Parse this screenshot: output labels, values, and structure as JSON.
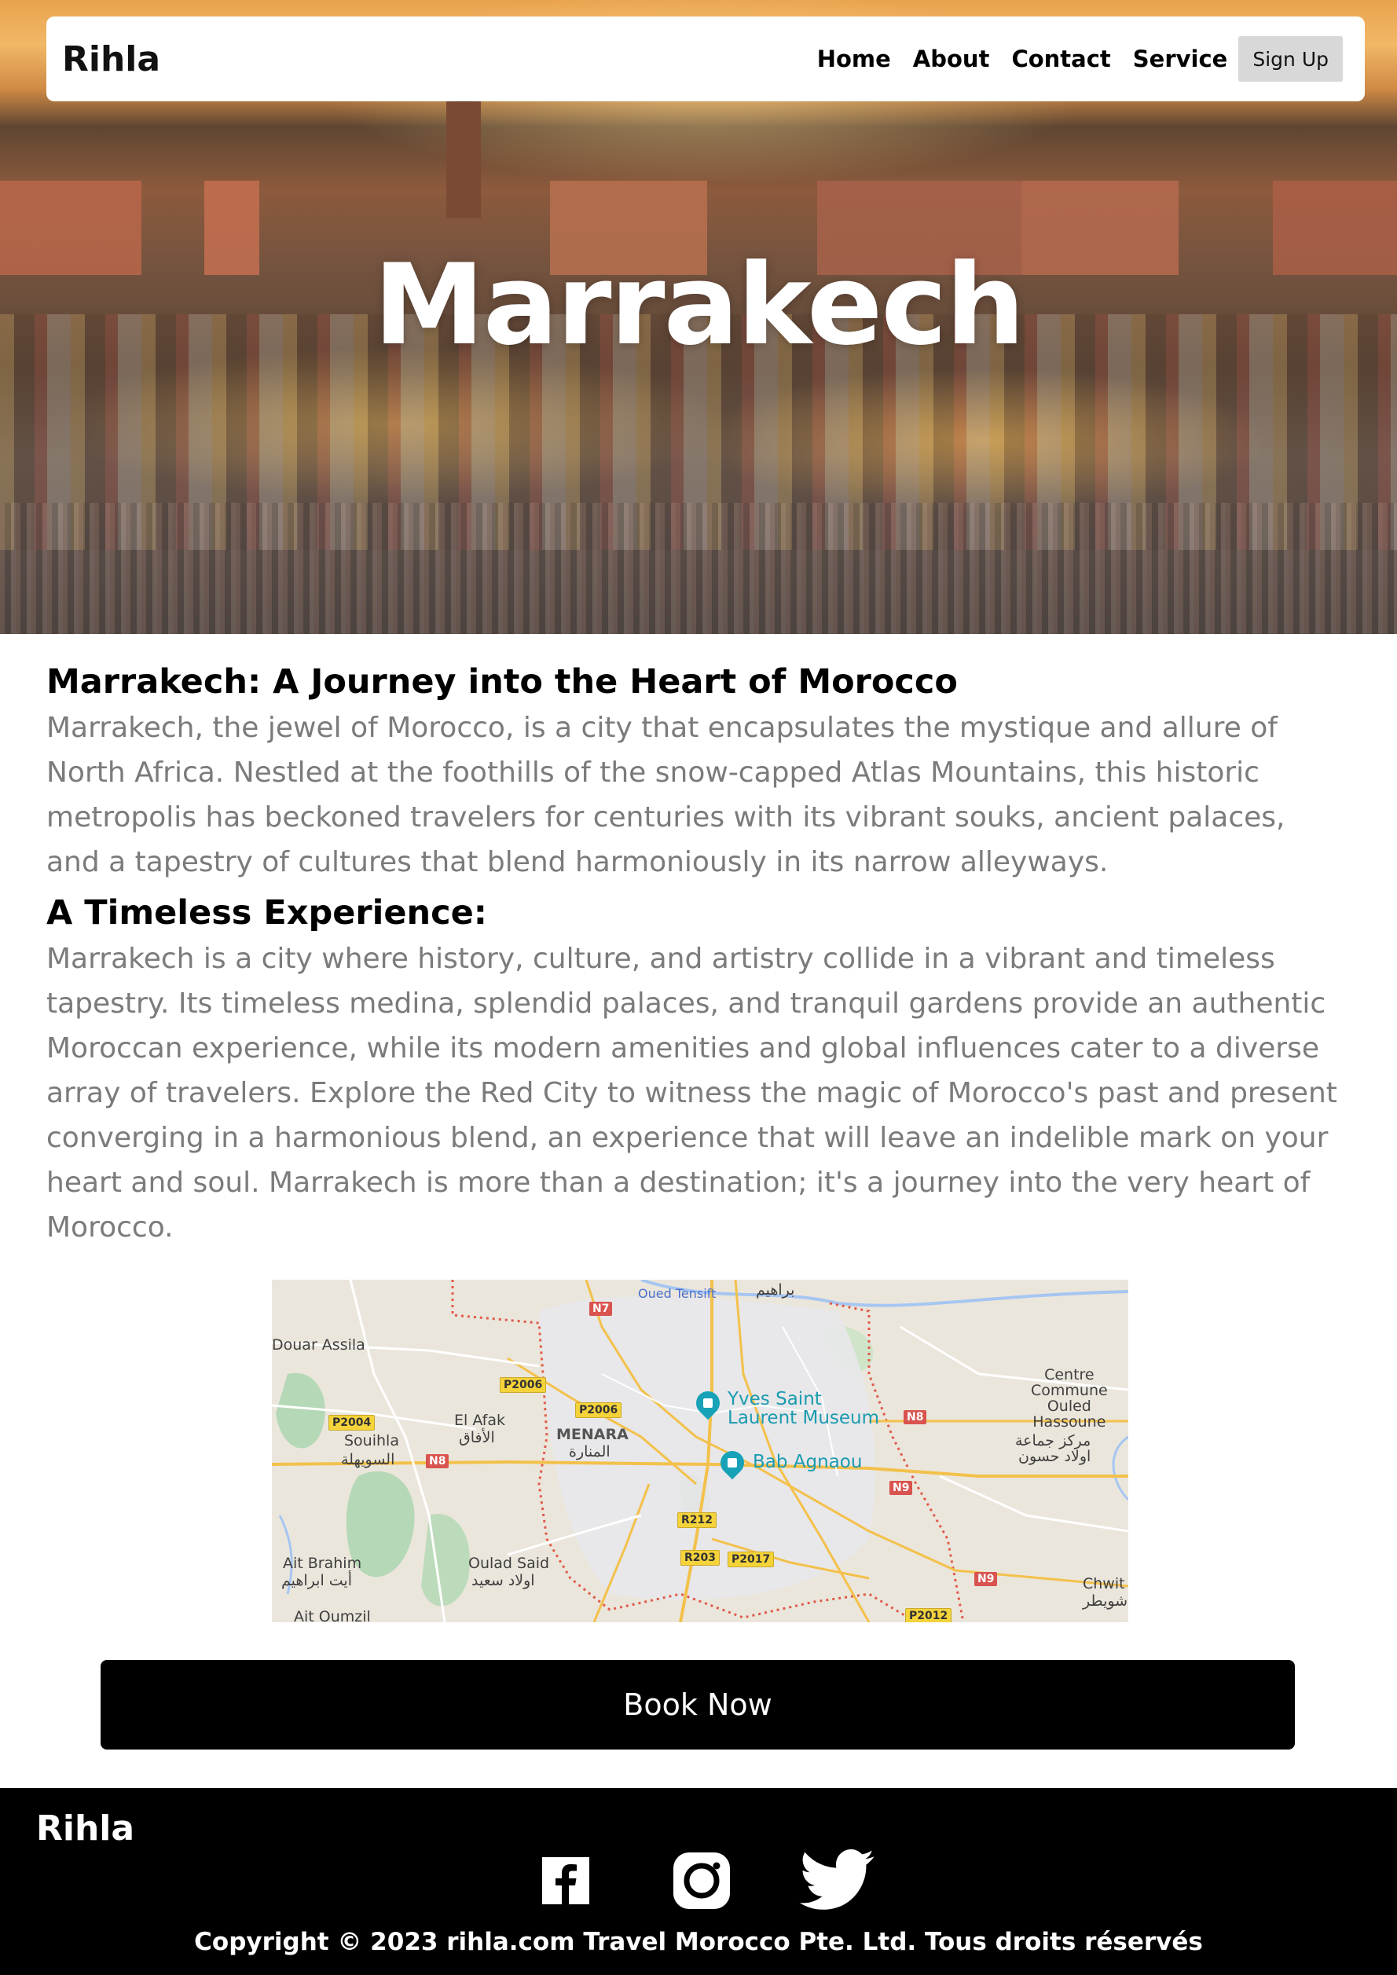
{
  "nav": {
    "brand": "Rihla",
    "links": [
      "Home",
      "About",
      "Contact",
      "Service"
    ],
    "signup_label": "Sign Up"
  },
  "hero": {
    "title": "Marrakech"
  },
  "article": {
    "heading1": "Marrakech: A Journey into the Heart of Morocco",
    "para1": "Marrakech, the jewel of Morocco, is a city that encapsulates the mystique and allure of North Africa. Nestled at the foothills of the snow-capped Atlas Mountains, this historic metropolis has beckoned travelers for centuries with its vibrant souks, ancient palaces, and a tapestry of cultures that blend harmoniously in its narrow alleyways.",
    "heading2": "A Timeless Experience:",
    "para2": "Marrakech is a city where history, culture, and artistry collide in a vibrant and timeless tapestry. Its timeless medina, splendid palaces, and tranquil gardens provide an authentic Moroccan experience, while its modern amenities and global influences cater to a diverse array of travelers. Explore the Red City to witness the magic of Morocco's past and present converging in a harmonious blend, an experience that will leave an indelible mark on your heart and soul. Marrakech is more than a destination; it's a journey into the very heart of Morocco."
  },
  "map": {
    "places": {
      "douar_assila": "Douar Assila",
      "el_afak": "El Afak",
      "el_afak_ar": "الأفاق",
      "souihla": "Souihla",
      "souihla_ar": "السويهلة",
      "menara": "MENARA",
      "menara_ar": "المنارة",
      "ysl_museum": "Yves Saint\nLaurent Museum",
      "bab_agnaou": "Bab Agnaou",
      "centre_ouled": "Centre\nCommune\nOuled\nHassoune",
      "centre_ouled_ar": "مركز جماعة\nاولاد حسون",
      "ait_brahim": "Ait Brahim",
      "ait_brahim_ar": "أيت ابراهيم",
      "oulad_said": "Oulad Said",
      "oulad_said_ar": "اولاد سعيد",
      "ait_oumzil": "Ait Oumzil",
      "chwiter": "Chwit",
      "chwiter_ar": "شويطر",
      "oued_tensift": "Oued Tensift",
      "top_ar": "براهيم"
    },
    "roads": {
      "n7": "N7",
      "n8_left": "N8",
      "n8_right": "N8",
      "n9_mid": "N9",
      "n9_right": "N9",
      "p2004": "P2004",
      "p2006_a": "P2006",
      "p2006_b": "P2006",
      "r212": "R212",
      "r203": "R203",
      "p2017": "P2017",
      "p2012": "P2012"
    }
  },
  "booking": {
    "button_label": "Book Now"
  },
  "footer": {
    "brand": "Rihla",
    "social": [
      "facebook-icon",
      "instagram-icon",
      "twitter-icon"
    ],
    "copyright": "Copyright © 2023 rihla.com Travel Morocco Pte. Ltd. Tous droits réservés"
  }
}
